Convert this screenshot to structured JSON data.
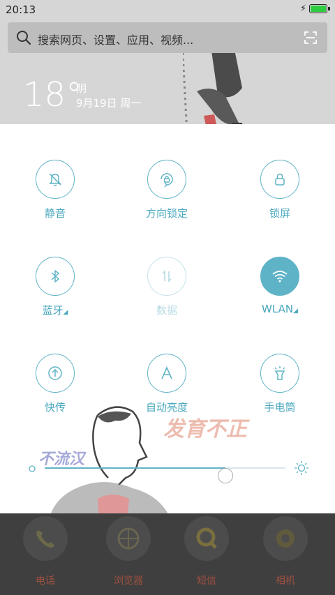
{
  "status_bar": {
    "time": "20:13"
  },
  "search": {
    "placeholder": "搜索网页、设置、应用、视频..."
  },
  "weather": {
    "temperature": "18°",
    "condition": "阴",
    "date": "9月19日 周一"
  },
  "toggles": [
    {
      "label": "静音",
      "icon": "bell-off-icon",
      "active": false,
      "enabled": true,
      "has_arrow": false
    },
    {
      "label": "方向锁定",
      "icon": "rotation-lock-icon",
      "active": false,
      "enabled": true,
      "has_arrow": false
    },
    {
      "label": "锁屏",
      "icon": "lock-icon",
      "active": false,
      "enabled": true,
      "has_arrow": false
    },
    {
      "label": "蓝牙",
      "icon": "bluetooth-icon",
      "active": false,
      "enabled": true,
      "has_arrow": true
    },
    {
      "label": "数据",
      "icon": "mobile-data-icon",
      "active": false,
      "enabled": false,
      "has_arrow": false
    },
    {
      "label": "WLAN",
      "icon": "wifi-icon",
      "active": true,
      "enabled": true,
      "has_arrow": true
    },
    {
      "label": "快传",
      "icon": "transfer-icon",
      "active": false,
      "enabled": true,
      "has_arrow": false
    },
    {
      "label": "自动亮度",
      "icon": "auto-brightness-icon",
      "active": false,
      "enabled": true,
      "has_arrow": false
    },
    {
      "label": "手电筒",
      "icon": "flashlight-icon",
      "active": false,
      "enabled": true,
      "has_arrow": false
    }
  ],
  "brightness": {
    "level": 0.75
  },
  "graffiti": {
    "text1": "发育不正",
    "text2": "不流汉"
  },
  "dock": [
    {
      "label": "电话",
      "icon": "phone-icon"
    },
    {
      "label": "浏览器",
      "icon": "browser-icon"
    },
    {
      "label": "短信",
      "icon": "sms-icon"
    },
    {
      "label": "相机",
      "icon": "camera-icon"
    }
  ],
  "colors": {
    "accent": "#5fb3c7",
    "accent_light": "#c5e2ea",
    "battery": "#2ecc40",
    "dock_bg": "#3f3f3f"
  }
}
